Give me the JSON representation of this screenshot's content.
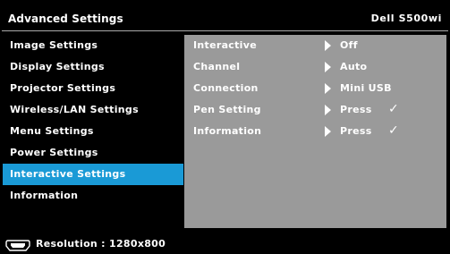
{
  "header": {
    "title": "Advanced Settings",
    "model": "Dell S500wi"
  },
  "sidebar": {
    "items": [
      {
        "label": "Image Settings",
        "active": false
      },
      {
        "label": "Display Settings",
        "active": false
      },
      {
        "label": "Projector Settings",
        "active": false
      },
      {
        "label": "Wireless/LAN Settings",
        "active": false
      },
      {
        "label": "Menu Settings",
        "active": false
      },
      {
        "label": "Power Settings",
        "active": false
      },
      {
        "label": "Interactive Settings",
        "active": true
      },
      {
        "label": "Information",
        "active": false
      }
    ]
  },
  "panel": {
    "rows": [
      {
        "label": "Interactive",
        "value": "Off",
        "check": ""
      },
      {
        "label": "Channel",
        "value": "Auto",
        "check": ""
      },
      {
        "label": "Connection",
        "value": "Mini USB",
        "check": ""
      },
      {
        "label": "Pen Setting",
        "value": "Press",
        "check": "✓"
      },
      {
        "label": "Information",
        "value": "Press",
        "check": "✓"
      }
    ]
  },
  "footer": {
    "icon": "hdmi-connector-icon",
    "resolution_text": "Resolution : 1280x800"
  },
  "colors": {
    "background": "#000000",
    "active_highlight": "#1a9ad6",
    "panel": "#9a9a9a",
    "text": "#ffffff"
  }
}
